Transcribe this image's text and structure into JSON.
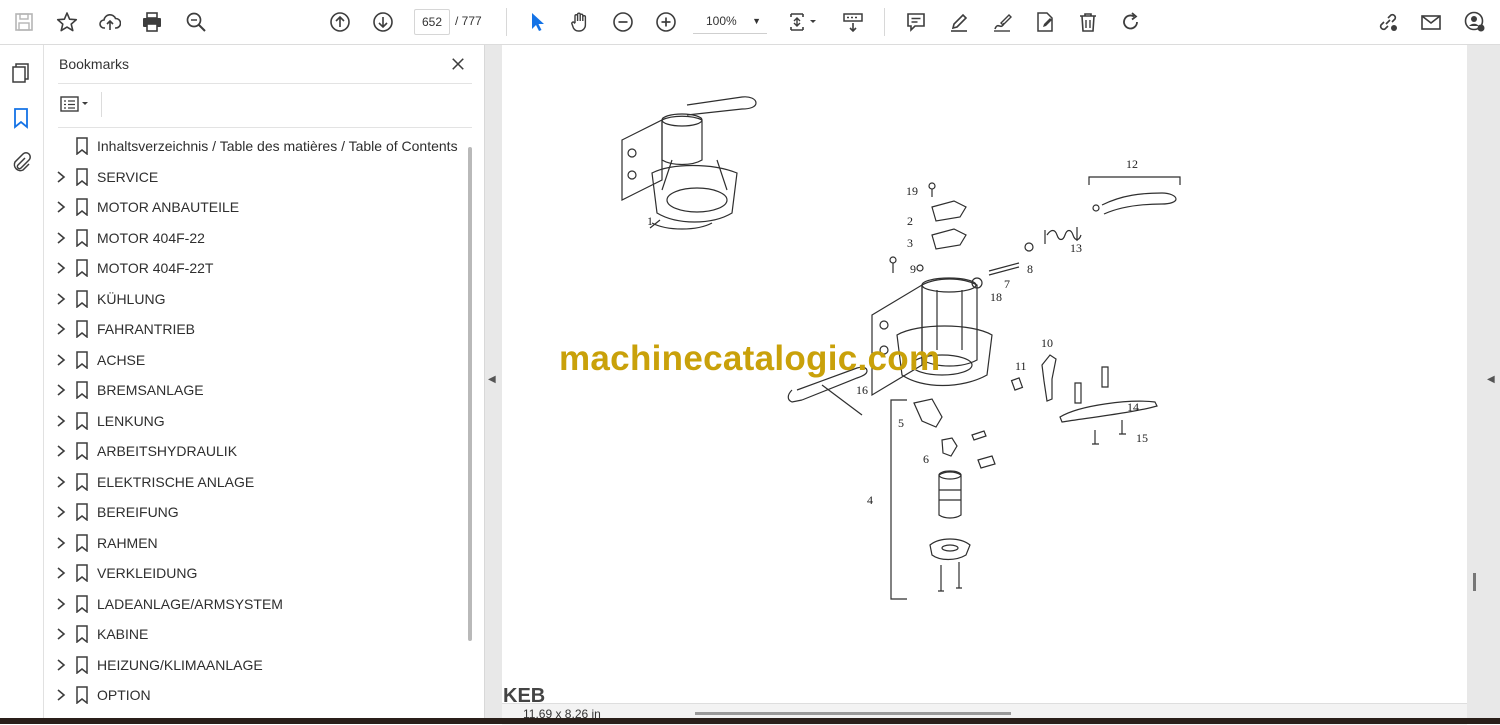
{
  "toolbar": {
    "page_current": "652",
    "page_total": "/  777",
    "zoom": "100%"
  },
  "panel": {
    "title": "Bookmarks",
    "bookmarks": [
      {
        "label": "Inhaltsverzeichnis / Table des matières / Table of Contents",
        "expandable": false
      },
      {
        "label": "SERVICE",
        "expandable": true
      },
      {
        "label": "MOTOR ANBAUTEILE",
        "expandable": true
      },
      {
        "label": "MOTOR 404F-22",
        "expandable": true
      },
      {
        "label": "MOTOR 404F-22T",
        "expandable": true
      },
      {
        "label": "KÜHLUNG",
        "expandable": true
      },
      {
        "label": "FAHRANTRIEB",
        "expandable": true
      },
      {
        "label": "ACHSE",
        "expandable": true
      },
      {
        "label": "BREMSANLAGE",
        "expandable": true
      },
      {
        "label": "LENKUNG",
        "expandable": true
      },
      {
        "label": "ARBEITSHYDRAULIK",
        "expandable": true
      },
      {
        "label": "ELEKTRISCHE ANLAGE",
        "expandable": true
      },
      {
        "label": "BEREIFUNG",
        "expandable": true
      },
      {
        "label": "RAHMEN",
        "expandable": true
      },
      {
        "label": "VERKLEIDUNG",
        "expandable": true
      },
      {
        "label": "LADEANLAGE/ARMSYSTEM",
        "expandable": true
      },
      {
        "label": "KABINE",
        "expandable": true
      },
      {
        "label": "HEIZUNG/KLIMAANLAGE",
        "expandable": true
      },
      {
        "label": "OPTION",
        "expandable": true
      }
    ]
  },
  "document": {
    "watermark": "machinecatalogic.com",
    "page_size": "11,69 x 8,26 in",
    "corner_logo": "KEB",
    "part_numbers": [
      "1",
      "2",
      "3",
      "4",
      "5",
      "6",
      "7",
      "8",
      "9",
      "10",
      "11",
      "12",
      "13",
      "14",
      "15",
      "16",
      "18",
      "19"
    ]
  },
  "colors": {
    "accent": "#1473e6",
    "watermark": "#c9a10a",
    "icon": "#3d3d3d"
  }
}
